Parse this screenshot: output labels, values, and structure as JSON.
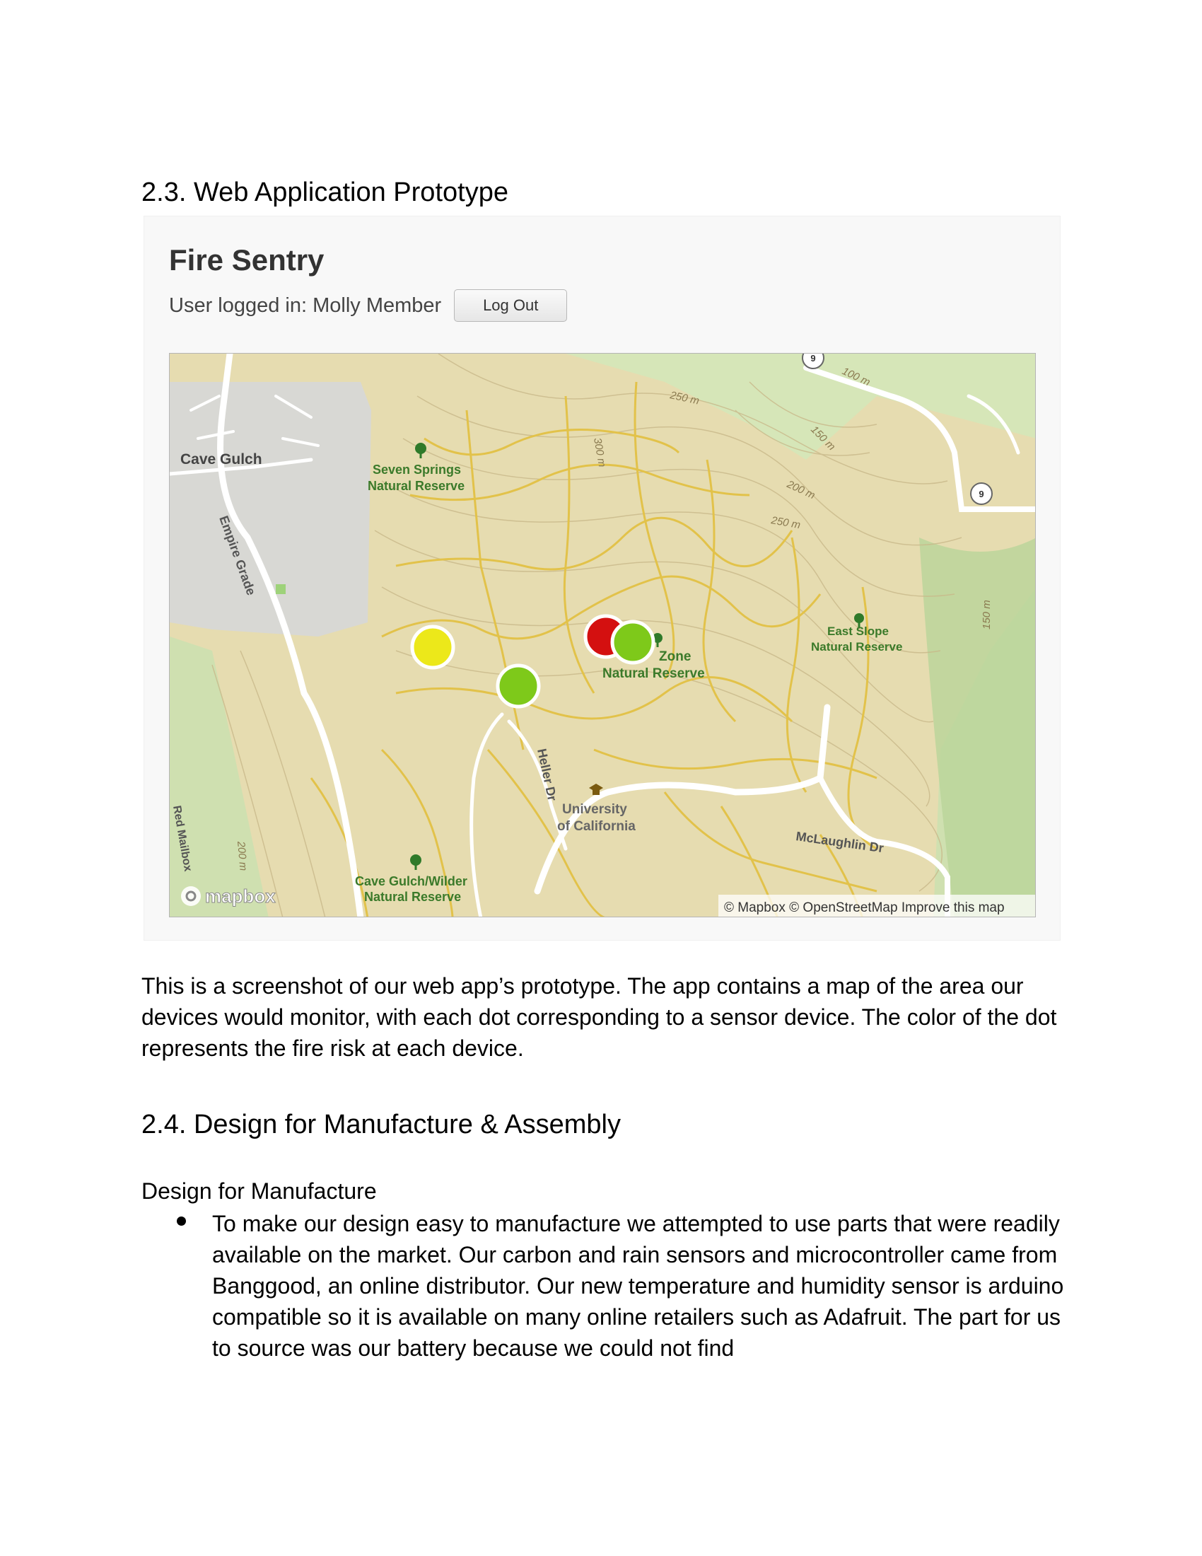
{
  "sections": {
    "web_app": {
      "heading": "2.3. Web Application Prototype"
    },
    "dfm": {
      "heading": "2.4. Design for Manufacture & Assembly"
    }
  },
  "app": {
    "title": "Fire Sentry",
    "user_label": "User logged in: Molly Member",
    "logout_label": "Log Out"
  },
  "map": {
    "labels": {
      "cave_gulch": "Cave Gulch",
      "seven_springs_1": "Seven Springs",
      "seven_springs_2": "Natural Reserve",
      "empire_grade": "Empire Grade",
      "east_slope_1": "East Slope",
      "east_slope_2": "Natural Reserve",
      "zone_1": "Zone",
      "zone_2": "Natural Reserve",
      "heller": "Heller Dr",
      "ucsc_1": "University",
      "ucsc_2": "of California",
      "mclaughlin": "McLaughlin Dr",
      "wilder_1": "Cave Gulch/Wilder",
      "wilder_2": "Natural Reserve",
      "mailbox": "Red Mailbox",
      "c250a": "250 m",
      "c300": "300 m",
      "c100": "100 m",
      "c150a": "150 m",
      "c200a": "200 m",
      "c250b": "250 m",
      "c150b": "150 m",
      "c200b": "200 m",
      "route9a": "9",
      "route9b": "9",
      "mapbox_logo": "mapbox",
      "attribution": "© Mapbox © OpenStreetMap Improve this map"
    },
    "sensor_colors": {
      "low": "#7ec91a",
      "medium": "#ece81a",
      "high": "#d41010"
    },
    "sensors": [
      {
        "risk": "medium"
      },
      {
        "risk": "low"
      },
      {
        "risk": "high"
      },
      {
        "risk": "low"
      }
    ]
  },
  "body": {
    "paragraph": "This is a screenshot of our web app’s prototype. The app contains a map of the area our devices would monitor, with each dot corresponding to a sensor device. The color of the dot represents the fire risk at each device.",
    "subheading": "Design for Manufacture",
    "bullet": "To make our design easy to manufacture we attempted to use parts that were readily available on the market. Our carbon and rain sensors and microcontroller came from Banggood, an online distributor. Our new temperature and humidity sensor is arduino compatible so it is available on many online retailers such as Adafruit. The part for us to source was our battery because we could not find"
  }
}
